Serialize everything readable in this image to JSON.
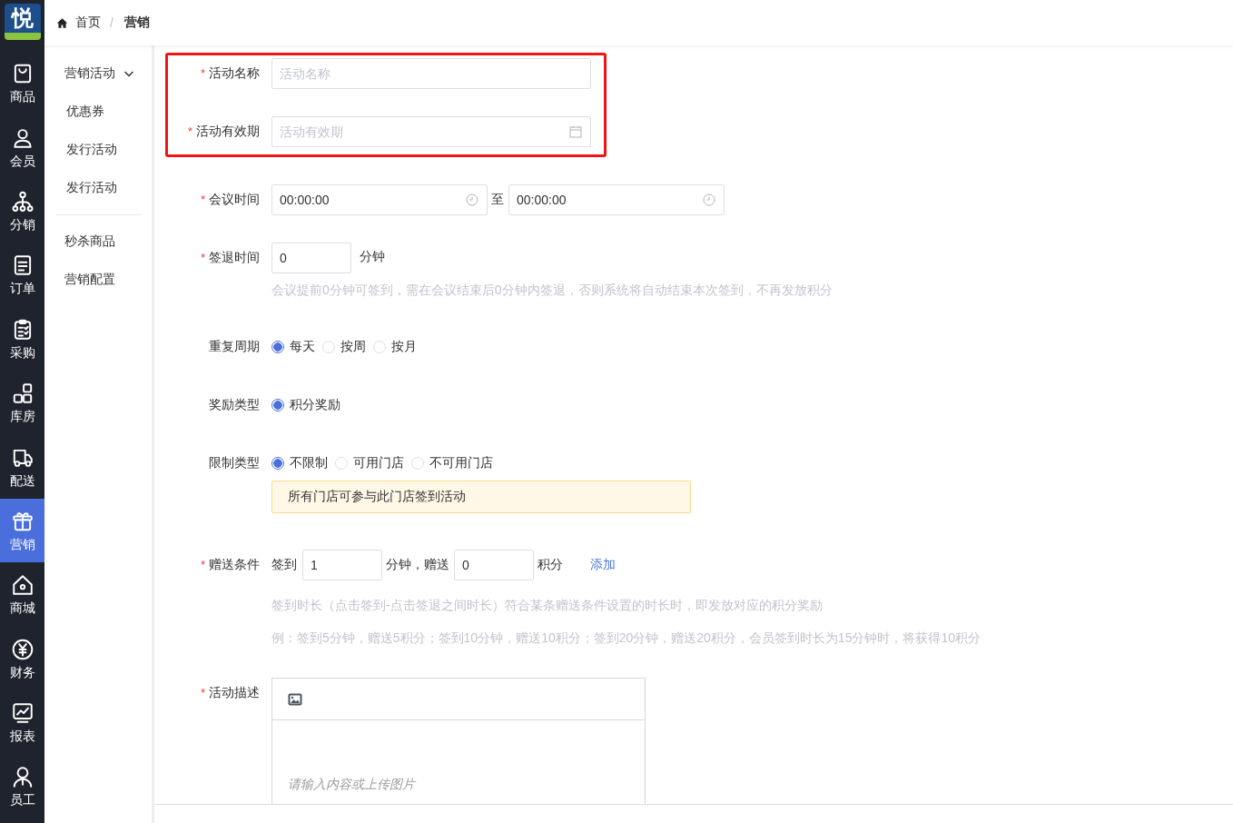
{
  "logo": {
    "text": "悦"
  },
  "rail": [
    {
      "label": "商品",
      "selected": false
    },
    {
      "label": "会员",
      "selected": false
    },
    {
      "label": "分销",
      "selected": false
    },
    {
      "label": "订单",
      "selected": false
    },
    {
      "label": "采购",
      "selected": false
    },
    {
      "label": "库房",
      "selected": false
    },
    {
      "label": "配送",
      "selected": false
    },
    {
      "label": "营销",
      "selected": true
    },
    {
      "label": "商城",
      "selected": false
    },
    {
      "label": "财务",
      "selected": false
    },
    {
      "label": "报表",
      "selected": false
    },
    {
      "label": "员工",
      "selected": false
    }
  ],
  "breadcrumb_separator": "/",
  "breadcrumb": [
    {
      "label": "首页",
      "current": false
    },
    {
      "label": "营销",
      "current": true
    }
  ],
  "submenu": [
    {
      "label": "营销活动",
      "expanded": true,
      "children": [
        {
          "label": "优惠券"
        },
        {
          "label": "发行活动"
        },
        {
          "label": "发行活动"
        }
      ]
    },
    {
      "label": "秒杀商品"
    },
    {
      "label": "营销配置"
    }
  ],
  "form": {
    "required_mark": "*",
    "rows": [
      {
        "kind": "text",
        "required": true,
        "highlighted": true,
        "label": "活动名称",
        "placeholder": "活动名称"
      },
      {
        "kind": "date",
        "required": true,
        "highlighted": true,
        "label": "活动有效期",
        "placeholder": "活动有效期"
      },
      {
        "kind": "timerange",
        "required": true,
        "label": "会议时间",
        "start": "00:00:00",
        "separator": "至",
        "end": "00:00:00"
      },
      {
        "kind": "number",
        "required": true,
        "label": "签退时间",
        "value": "0",
        "unit": "分钟",
        "hints": [
          "会议提前0分钟可签到，需在会议结束后0分钟内签退，否则系统将自动结束本次签到，不再发放积分"
        ]
      },
      {
        "kind": "radio",
        "required": false,
        "label": "重复周期",
        "options": [
          {
            "label": "每天",
            "selected": true
          },
          {
            "label": "按周",
            "selected": false
          },
          {
            "label": "按月",
            "selected": false
          }
        ]
      },
      {
        "kind": "radio",
        "required": false,
        "label": "奖励类型",
        "options": [
          {
            "label": "积分奖励",
            "selected": true
          }
        ]
      },
      {
        "kind": "radio",
        "required": false,
        "label": "限制类型",
        "options": [
          {
            "label": "不限制",
            "selected": true
          },
          {
            "label": "可用门店",
            "selected": false
          },
          {
            "label": "不可用门店",
            "selected": false
          }
        ],
        "notice": "所有门店可参与此门店签到活动"
      },
      {
        "kind": "condition",
        "required": true,
        "label": "赠送条件",
        "prefix": "签到",
        "minutes": "1",
        "middle": "分钟，赠送",
        "points": "0",
        "suffix": "积分",
        "link": "添加",
        "hints": [
          "签到时长（点击签到-点击签退之间时长）符合某条赠送条件设置的时长时，即发放对应的积分奖励",
          "例：签到5分钟，赠送5积分；签到10分钟，赠送10积分；签到20分钟，赠送20积分，会员签到时长为15分钟时，将获得10积分"
        ]
      },
      {
        "kind": "editor",
        "required": true,
        "label": "活动描述",
        "placeholder": "请输入内容或上传图片"
      }
    ]
  }
}
